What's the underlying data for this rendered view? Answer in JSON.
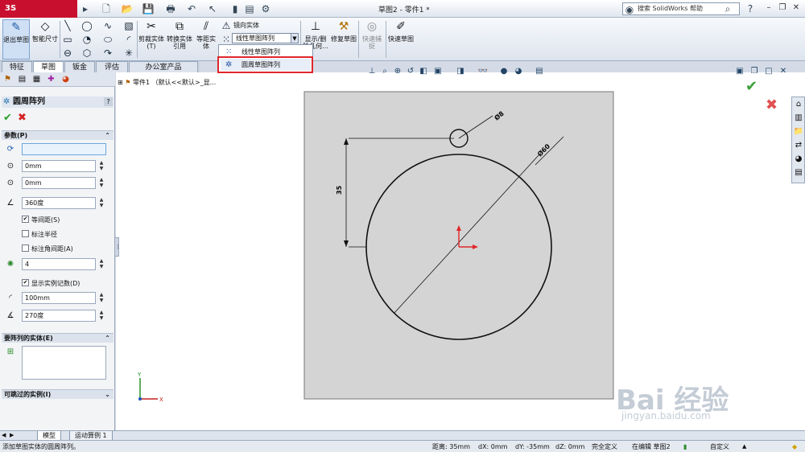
{
  "titlebar": {
    "logo": "3S SOLIDWORKS",
    "document_title": "草图2 - 零件1 *",
    "help_search_placeholder": "搜索 SolidWorks 帮助",
    "help_icon": "?"
  },
  "cmd": {
    "exit_sketch": "退出草图",
    "smart_dim": "智能尺寸",
    "trim": "剪裁实体(T)",
    "convert": "转换实体引用",
    "offset": "等距实体",
    "mirror": "镜向实体",
    "pattern_selected": "线性草图阵列",
    "display_delete": "显示/删除几何...",
    "repair": "修复草图",
    "quick_snap": "快速捕捉",
    "rapid_sketch": "快速草图"
  },
  "dropdown": {
    "items": [
      "线性草图阵列",
      "圆周草图阵列"
    ]
  },
  "tabs": [
    "特征",
    "草图",
    "钣金",
    "评估",
    "办公室产品"
  ],
  "active_tab": "草图",
  "pm": {
    "title": "圆周阵列",
    "help": "?",
    "ok": "✔",
    "cancel": "✖",
    "params_header": "参数(P)",
    "center_x": "0mm",
    "center_y": "0mm",
    "angle": "360度",
    "equal_spacing": "等间距(S)",
    "dim_radius": "标注半径",
    "dim_angle_spacing": "标注角间距(A)",
    "instances": "4",
    "show_count": "显示实例记数(D)",
    "radius": "100mm",
    "arc_angle": "270度",
    "entities_header": "要阵列的实体(E)",
    "skip_header": "可跳过的实例(I)"
  },
  "tree": {
    "root": "零件1 （默认<<默认>_显..."
  },
  "drawing": {
    "dim_small": "Ø8",
    "dim_large": "Ø60",
    "dim_vertical": "35"
  },
  "bottom_tabs": [
    "模型",
    "运动算例 1"
  ],
  "status": {
    "hint": "添加草图实体的圆周阵列。",
    "distance": "距离: 35mm",
    "dx": "dX: 0mm",
    "dy": "dY: -35mm",
    "dz": "dZ: 0mm",
    "defined": "完全定义",
    "editing": "在编辑 草图2",
    "custom": "自定义"
  },
  "watermark": {
    "brand": "Bai  经验",
    "url": "jingyan.baidu.com"
  },
  "colors": {
    "accent_red": "#e0262a",
    "confirm_green": "#2aa02a",
    "cancel_red": "#d42020",
    "sheet_gray": "#d4d4d4"
  }
}
